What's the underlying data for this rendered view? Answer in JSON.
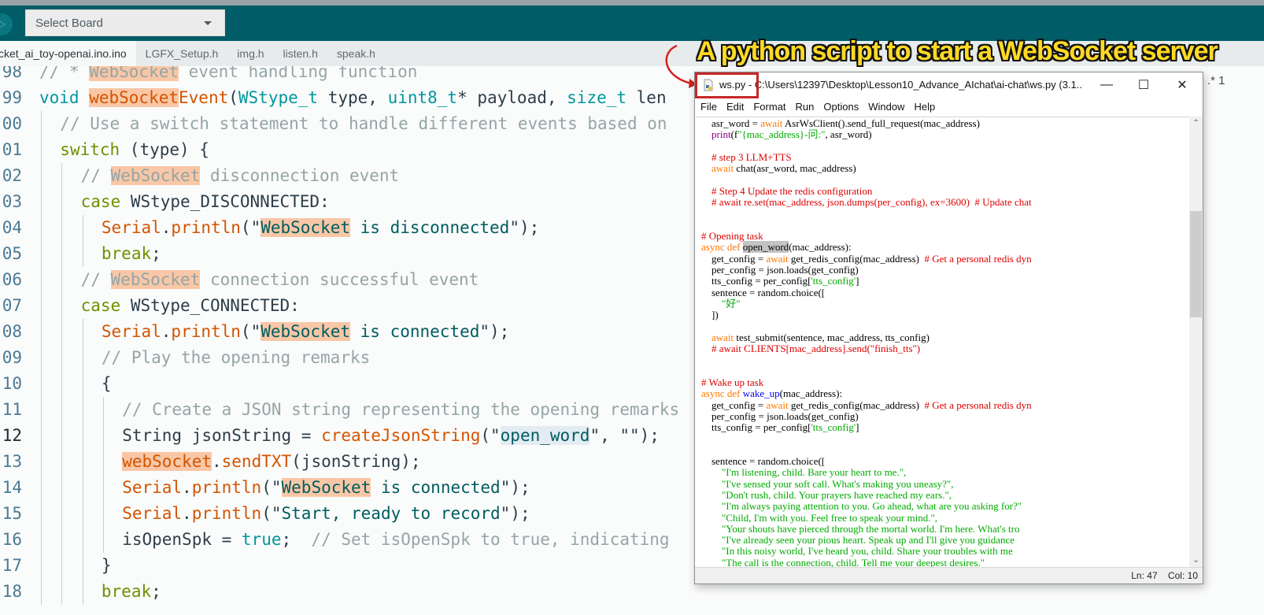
{
  "toolbar": {
    "upload_icon": "upload-arrow-icon",
    "board_select_value": "Select Board"
  },
  "tabs": [
    {
      "label": "cket_ai_toy-openai.ino.ino",
      "active": true
    },
    {
      "label": "LGFX_Setup.h",
      "active": false
    },
    {
      "label": "img.h",
      "active": false
    },
    {
      "label": "listen.h",
      "active": false
    },
    {
      "label": "speak.h",
      "active": false
    }
  ],
  "editor": {
    "current_line": "12",
    "lines": [
      {
        "n": "98",
        "indent": 0,
        "segs": [
          [
            "c-cmt",
            "// * "
          ],
          [
            "c-cmt hl",
            "WebSocket"
          ],
          [
            "c-cmt",
            " event handling function"
          ]
        ]
      },
      {
        "n": "99",
        "indent": 0,
        "segs": [
          [
            "c-kw",
            "void "
          ],
          [
            "c-fn hl",
            "webSocket"
          ],
          [
            "c-fn",
            "Event"
          ],
          [
            "c-txt",
            "("
          ],
          [
            "c-kw",
            "WStype_t"
          ],
          [
            "c-txt",
            " type, "
          ],
          [
            "c-kw",
            "uint8_t"
          ],
          [
            "c-txt",
            "* payload, "
          ],
          [
            "c-kw",
            "size_t"
          ],
          [
            "c-txt",
            " len"
          ]
        ]
      },
      {
        "n": "00",
        "indent": 1,
        "segs": [
          [
            "c-cmt",
            "// Use a switch statement to handle different events based on"
          ]
        ]
      },
      {
        "n": "01",
        "indent": 1,
        "segs": [
          [
            "c-ctl",
            "switch"
          ],
          [
            "c-txt",
            " (type) {"
          ]
        ]
      },
      {
        "n": "02",
        "indent": 2,
        "segs": [
          [
            "c-cmt",
            "// "
          ],
          [
            "c-cmt hl",
            "WebSocket"
          ],
          [
            "c-cmt",
            " disconnection event"
          ]
        ]
      },
      {
        "n": "03",
        "indent": 2,
        "segs": [
          [
            "c-ctl",
            "case"
          ],
          [
            "c-txt",
            " WStype_DISCONNECTED:"
          ]
        ]
      },
      {
        "n": "04",
        "indent": 3,
        "segs": [
          [
            "c-fn",
            "Serial"
          ],
          [
            "c-txt",
            "."
          ],
          [
            "c-fn",
            "println"
          ],
          [
            "c-txt",
            "(\""
          ],
          [
            "c-str hl",
            "WebSocket"
          ],
          [
            "c-str",
            " is disconnected"
          ],
          [
            "c-txt",
            "\");"
          ]
        ]
      },
      {
        "n": "05",
        "indent": 3,
        "segs": [
          [
            "c-ctl",
            "break"
          ],
          [
            "c-txt",
            ";"
          ]
        ]
      },
      {
        "n": "06",
        "indent": 2,
        "segs": [
          [
            "c-cmt",
            "// "
          ],
          [
            "c-cmt hl",
            "WebSocket"
          ],
          [
            "c-cmt",
            " connection successful event"
          ]
        ]
      },
      {
        "n": "07",
        "indent": 2,
        "segs": [
          [
            "c-ctl",
            "case"
          ],
          [
            "c-txt",
            " WStype_CONNECTED:"
          ]
        ]
      },
      {
        "n": "08",
        "indent": 3,
        "segs": [
          [
            "c-fn",
            "Serial"
          ],
          [
            "c-txt",
            "."
          ],
          [
            "c-fn",
            "println"
          ],
          [
            "c-txt",
            "(\""
          ],
          [
            "c-str hl",
            "WebSocket"
          ],
          [
            "c-str",
            " is connected"
          ],
          [
            "c-txt",
            "\");"
          ]
        ]
      },
      {
        "n": "09",
        "indent": 3,
        "segs": [
          [
            "c-cmt",
            "// Play the opening remarks"
          ]
        ]
      },
      {
        "n": "10",
        "indent": 3,
        "segs": [
          [
            "c-txt",
            "{"
          ]
        ]
      },
      {
        "n": "11",
        "indent": 4,
        "segs": [
          [
            "c-cmt",
            "// Create a JSON string representing the opening remarks"
          ]
        ]
      },
      {
        "n": "12",
        "indent": 4,
        "segs": [
          [
            "c-txt",
            "String jsonString = "
          ],
          [
            "c-fn",
            "createJsonString"
          ],
          [
            "c-txt",
            "(\""
          ],
          [
            "c-str sel",
            "open_word"
          ],
          [
            "c-txt",
            "\", \"\");"
          ]
        ]
      },
      {
        "n": "13",
        "indent": 4,
        "segs": [
          [
            "c-fn hl",
            "webSocket"
          ],
          [
            "c-txt",
            "."
          ],
          [
            "c-fn",
            "sendTXT"
          ],
          [
            "c-txt",
            "(jsonString);"
          ]
        ]
      },
      {
        "n": "14",
        "indent": 4,
        "segs": [
          [
            "c-fn",
            "Serial"
          ],
          [
            "c-txt",
            "."
          ],
          [
            "c-fn",
            "println"
          ],
          [
            "c-txt",
            "(\""
          ],
          [
            "c-str hl",
            "WebSocket"
          ],
          [
            "c-str",
            " is connected"
          ],
          [
            "c-txt",
            "\");"
          ]
        ]
      },
      {
        "n": "15",
        "indent": 4,
        "segs": [
          [
            "c-fn",
            "Serial"
          ],
          [
            "c-txt",
            "."
          ],
          [
            "c-fn",
            "println"
          ],
          [
            "c-txt",
            "(\""
          ],
          [
            "c-str",
            "Start, ready to record"
          ],
          [
            "c-txt",
            "\");"
          ]
        ]
      },
      {
        "n": "16",
        "indent": 4,
        "segs": [
          [
            "c-txt",
            "isOpenSpk = "
          ],
          [
            "c-kw",
            "true"
          ],
          [
            "c-txt",
            ";  "
          ],
          [
            "c-cmt",
            "// Set isOpenSpk to true, indicating"
          ]
        ]
      },
      {
        "n": "17",
        "indent": 3,
        "segs": [
          [
            "c-txt",
            "}"
          ]
        ]
      },
      {
        "n": "18",
        "indent": 3,
        "segs": [
          [
            "c-ctl",
            "break"
          ],
          [
            "c-txt",
            ";"
          ]
        ]
      }
    ]
  },
  "caption": {
    "text": "A python script to start a WebSocket server",
    "color": "#ffd924"
  },
  "idle_window": {
    "title": "ws.py - C:\\Users\\12397\\Desktop\\Lesson10_Advance_AIchat\\ai-chat\\ws.py (3.1...",
    "controls": {
      "minimize": "—",
      "maximize": "☐",
      "close": "✕"
    },
    "menu": [
      "File",
      "Edit",
      "Format",
      "Run",
      "Options",
      "Window",
      "Help"
    ],
    "status": {
      "line": "Ln: 47",
      "col": "Col: 10"
    },
    "code": [
      [
        [
          "",
          "    asr_word = "
        ],
        [
          "p-kw",
          "await"
        ],
        [
          "",
          " AsrWsClient().send_full_request(mac_address)"
        ]
      ],
      [
        [
          "",
          "    "
        ],
        [
          "p-bi",
          "print"
        ],
        [
          "",
          "(f"
        ],
        [
          "p-str",
          "\"{mac_address}-问:\""
        ],
        [
          "",
          ", asr_word)"
        ]
      ],
      [],
      [
        [
          "p-cmt",
          "    # step 3 LLM+TTS"
        ]
      ],
      [
        [
          "",
          "    "
        ],
        [
          "p-kw",
          "await"
        ],
        [
          "",
          " chat(asr_word, mac_address)"
        ]
      ],
      [],
      [
        [
          "p-cmt",
          "    # Step 4 Update the redis configuration"
        ]
      ],
      [
        [
          "p-cmt",
          "    # await re.set(mac_address, json.dumps(per_config), ex=3600)  # Update chat"
        ]
      ],
      [],
      [],
      [
        [
          "p-cmt",
          "# Opening task"
        ]
      ],
      [
        [
          "p-kw",
          "async def "
        ],
        [
          "p-sel",
          "open_word"
        ],
        [
          "",
          "(mac_address):"
        ]
      ],
      [
        [
          "",
          "    get_config = "
        ],
        [
          "p-kw",
          "await"
        ],
        [
          "",
          " get_redis_config(mac_address)  "
        ],
        [
          "p-cmt",
          "# Get a personal redis dyn"
        ]
      ],
      [
        [
          "",
          "    per_config = json.loads(get_config)"
        ]
      ],
      [
        [
          "",
          "    tts_config = per_config["
        ],
        [
          "p-str",
          "'tts_config'"
        ],
        [
          "",
          "]"
        ]
      ],
      [
        [
          "",
          "    sentence = random.choice(["
        ]
      ],
      [
        [
          "p-str",
          "        \"好\""
        ]
      ],
      [
        [
          "",
          "    ])"
        ]
      ],
      [],
      [
        [
          "",
          "    "
        ],
        [
          "p-kw",
          "await"
        ],
        [
          "",
          " test_submit(sentence, mac_address, tts_config)"
        ]
      ],
      [
        [
          "p-cmt",
          "    # await CLIENTS[mac_address].send(\"finish_tts\")"
        ]
      ],
      [],
      [],
      [
        [
          "p-cmt",
          "# Wake up task"
        ]
      ],
      [
        [
          "p-kw",
          "async def "
        ],
        [
          "p-def",
          "wake_up"
        ],
        [
          "",
          "(mac_address):"
        ]
      ],
      [
        [
          "",
          "    get_config = "
        ],
        [
          "p-kw",
          "await"
        ],
        [
          "",
          " get_redis_config(mac_address)  "
        ],
        [
          "p-cmt",
          "# Get a personal redis dyn"
        ]
      ],
      [
        [
          "",
          "    per_config = json.loads(get_config)"
        ]
      ],
      [
        [
          "",
          "    tts_config = per_config["
        ],
        [
          "p-str",
          "'tts_config'"
        ],
        [
          "",
          "]"
        ]
      ],
      [],
      [],
      [
        [
          "",
          "    sentence = random.choice(["
        ]
      ],
      [
        [
          "p-str",
          "        \"I'm listening, child. Bare your heart to me.\","
        ]
      ],
      [
        [
          "p-str",
          "        \"I've sensed your soft call. What's making you uneasy?\","
        ]
      ],
      [
        [
          "p-str",
          "        \"Don't rush, child. Your prayers have reached my ears.\","
        ]
      ],
      [
        [
          "p-str",
          "        \"I'm always paying attention to you. Go ahead, what are you asking for?\""
        ]
      ],
      [
        [
          "p-str",
          "        \"Child, I'm with you. Feel free to speak your mind.\","
        ]
      ],
      [
        [
          "p-str",
          "        \"Your shouts have pierced through the mortal world. I'm here. What's tro"
        ]
      ],
      [
        [
          "p-str",
          "        \"I've already seen your pious heart. Speak up and I'll give you guidance"
        ]
      ],
      [
        [
          "p-str",
          "        \"In this noisy world, I've heard you, child. Share your troubles with me"
        ]
      ],
      [
        [
          "p-str",
          "        \"The call is the connection, child. Tell me your deepest desires.\""
        ]
      ]
    ]
  },
  "right_edge_text": ".* 1"
}
